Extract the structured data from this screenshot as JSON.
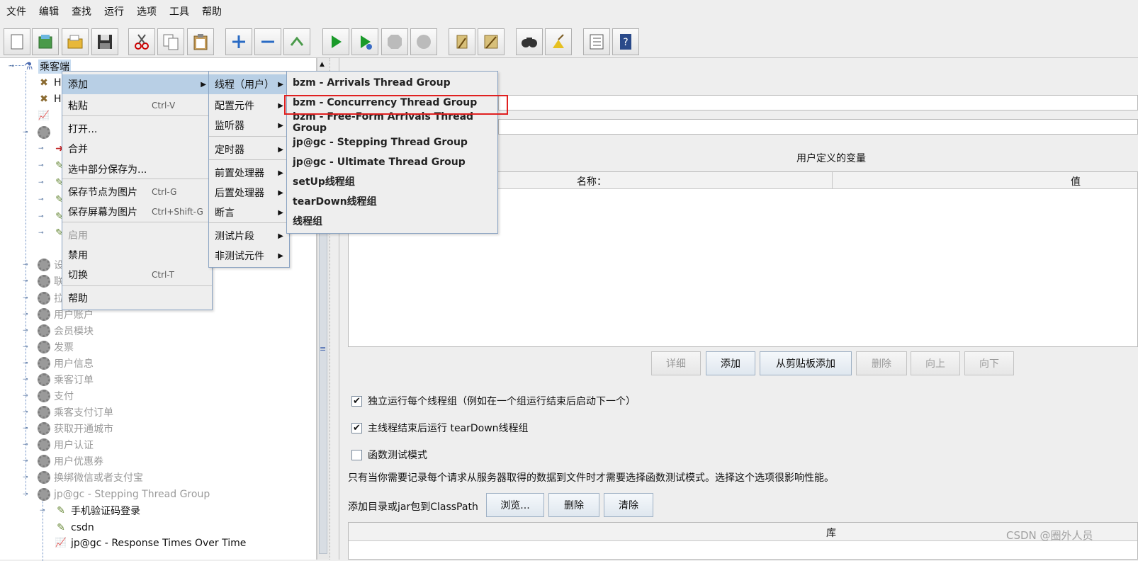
{
  "menubar": [
    "文件",
    "编辑",
    "查找",
    "运行",
    "选项",
    "工具",
    "帮助"
  ],
  "toolbar_icons": [
    "new-icon",
    "templates-icon",
    "open-icon",
    "save-icon",
    "cut-icon",
    "copy-icon",
    "paste-icon",
    "expand-icon",
    "collapse-icon",
    "toggle-icon",
    "start-icon",
    "start-no-pause-icon",
    "stop-icon",
    "shutdown-icon",
    "clear-icon",
    "clear-all-icon",
    "search-icon",
    "reset-search-icon",
    "function-helper-icon",
    "help-icon"
  ],
  "tree": {
    "root": "乘客端",
    "rows": [
      {
        "label": "H",
        "icon": "tools-icon"
      },
      {
        "label": "H",
        "icon": "tools-icon"
      },
      {
        "label": "",
        "icon": "graph-icon"
      },
      {
        "label": "",
        "icon": "gear-icon"
      },
      {
        "label": "",
        "icon": "sampler-icon"
      },
      {
        "label": "",
        "icon": "pencil-icon"
      },
      {
        "label": "",
        "icon": "pencil-icon"
      },
      {
        "label": "",
        "icon": "pencil-icon"
      },
      {
        "label": "",
        "icon": "pencil-icon"
      },
      {
        "label": "",
        "icon": "pencil-icon"
      },
      {
        "label": "设",
        "icon": "gear-icon"
      },
      {
        "label": "联",
        "icon": "gear-icon"
      },
      {
        "label": "拉",
        "icon": "gear-icon"
      },
      {
        "label": "用户账户",
        "icon": "gear-icon"
      },
      {
        "label": "会员模块",
        "icon": "gear-icon"
      },
      {
        "label": "发票",
        "icon": "gear-icon"
      },
      {
        "label": "用户信息",
        "icon": "gear-icon"
      },
      {
        "label": "乘客订单",
        "icon": "gear-icon"
      },
      {
        "label": "支付",
        "icon": "gear-icon"
      },
      {
        "label": "乘客支付订单",
        "icon": "gear-icon"
      },
      {
        "label": "获取开通城市",
        "icon": "gear-icon"
      },
      {
        "label": "用户认证",
        "icon": "gear-icon"
      },
      {
        "label": "用户优惠券",
        "icon": "gear-icon"
      },
      {
        "label": "换绑微信或者支付宝",
        "icon": "gear-icon"
      },
      {
        "label": "jp@gc - Stepping Thread Group",
        "icon": "gear-icon"
      },
      {
        "label": "手机验证码登录",
        "icon": "pencil-icon"
      },
      {
        "label": "csdn",
        "icon": "pencil-icon"
      },
      {
        "label": "jp@gc - Response Times Over Time",
        "icon": "graph-icon"
      }
    ]
  },
  "context_menu": {
    "items": [
      {
        "label": "添加",
        "shortcut": "",
        "submenu": true,
        "selected": true,
        "disabled": false
      },
      {
        "label": "粘贴",
        "shortcut": "Ctrl-V"
      },
      {
        "label": "打开...",
        "shortcut": ""
      },
      {
        "label": "合并",
        "shortcut": ""
      },
      {
        "label": "选中部分保存为...",
        "shortcut": ""
      },
      {
        "label": "保存节点为图片",
        "shortcut": "Ctrl-G"
      },
      {
        "label": "保存屏幕为图片",
        "shortcut": "Ctrl+Shift-G"
      },
      {
        "label": "启用",
        "shortcut": "",
        "disabled": true
      },
      {
        "label": "禁用",
        "shortcut": ""
      },
      {
        "label": "切换",
        "shortcut": "Ctrl-T"
      },
      {
        "label": "帮助",
        "shortcut": ""
      }
    ]
  },
  "add_submenu": {
    "items": [
      "线程（用户）",
      "配置元件",
      "监听器",
      "定时器",
      "前置处理器",
      "后置处理器",
      "断言",
      "测试片段",
      "非测试元件"
    ]
  },
  "thread_submenu": {
    "items": [
      "bzm - Arrivals Thread Group",
      "bzm - Concurrency Thread Group",
      "bzm - Free-Form Arrivals Thread Group",
      "jp@gc - Stepping Thread Group",
      "jp@gc - Ultimate Thread Group",
      "setUp线程组",
      "tearDown线程组",
      "线程组"
    ],
    "highlighted": "bzm - Concurrency Thread Group"
  },
  "right_panel": {
    "vars_title": "用户定义的变量",
    "col_name": "名称：",
    "col_value": "值",
    "buttons": {
      "detail": "详细",
      "add": "添加",
      "add_clipboard": "从剪贴板添加",
      "delete": "删除",
      "up": "向上",
      "down": "向下"
    },
    "checks": [
      {
        "label": "独立运行每个线程组（例如在一个组运行结束后启动下一个）",
        "checked": true
      },
      {
        "label": "主线程结束后运行 tearDown线程组",
        "checked": true
      },
      {
        "label": "函数测试模式",
        "checked": false
      }
    ],
    "note": "只有当你需要记录每个请求从服务器取得的数据到文件时才需要选择函数测试模式。选择这个选项很影响性能。",
    "classpath_label": "添加目录或jar包到ClassPath",
    "classpath_buttons": {
      "browse": "浏览...",
      "delete": "删除",
      "clear": "清除"
    },
    "lib_header": "库"
  },
  "watermark": "CSDN @圈外人员",
  "colors": {
    "highlight": "#b8cfe5",
    "redbox": "#e02020",
    "menu_border": "#8aa3c2"
  }
}
